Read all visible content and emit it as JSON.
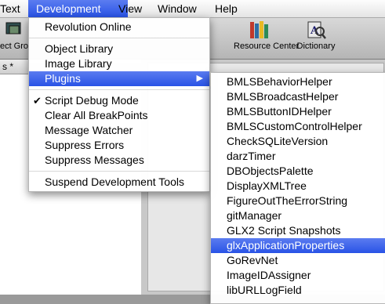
{
  "menubar": {
    "items": [
      "Text",
      "Development",
      "View",
      "Window",
      "Help"
    ],
    "active": "Development"
  },
  "toolbar": {
    "items": [
      {
        "label": "ect Gro",
        "icon": "group-icon"
      },
      {
        "label": "Resource Center",
        "icon": "books-icon"
      },
      {
        "label": "Dictionary",
        "icon": "dictionary-icon"
      }
    ]
  },
  "back_window": {
    "tab_label": "s *"
  },
  "development_menu": {
    "items": [
      "Revolution Online",
      "Object Library",
      "Image Library",
      "Plugins",
      "Script Debug Mode",
      "Clear All BreakPoints",
      "Message Watcher",
      "Suppress Errors",
      "Suppress Messages",
      "Suspend Development Tools"
    ],
    "checked": "Script Debug Mode",
    "submenu_arrow": "▶"
  },
  "plugins_menu": {
    "items": [
      "BMLSBehaviorHelper",
      "BMLSBroadcastHelper",
      "BMLSButtonIDHelper",
      "BMLSCustomControlHelper",
      "CheckSQLiteVersion",
      "darzTimer",
      "DBObjectsPalette",
      "DisplayXMLTree",
      "FigureOutTheErrorString",
      "gitManager",
      "GLX2 Script Snapshots",
      "glxApplicationProperties",
      "GoRevNet",
      "ImageIDAssigner",
      "libURLLogField"
    ],
    "highlighted": "glxApplicationProperties"
  },
  "colors": {
    "highlight": "#2953e6",
    "menu_bg": "#ffffff"
  }
}
